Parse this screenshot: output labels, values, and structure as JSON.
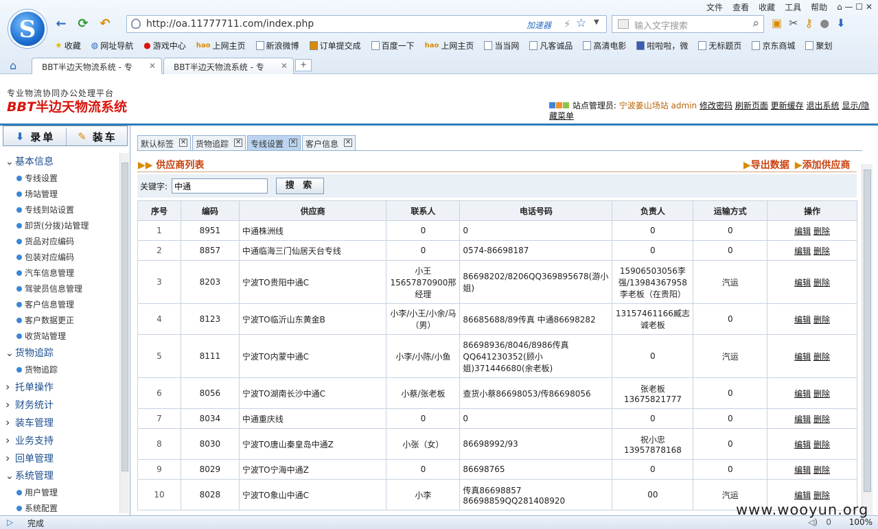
{
  "browser": {
    "menus": [
      "文件",
      "查看",
      "收藏",
      "工具",
      "帮助"
    ],
    "url": "http://oa.11777711.com/index.php",
    "accelerator": "加速器",
    "search_placeholder": "输入文字搜索",
    "favorites": [
      "收藏",
      "网址导航",
      "游戏中心",
      "上网主页",
      "新浪微博",
      "订单提交成",
      "百度一下",
      "上网主页",
      "当当网",
      "凡客诚品",
      "高清电影",
      "啦啦啦，微",
      "无标题页",
      "京东商城",
      "聚划"
    ],
    "tabs": [
      "BBT半边天物流系统 - 专",
      "BBT半边天物流系统 - 专"
    ],
    "status_text": "完成",
    "zoom": "100%",
    "status_count": "0"
  },
  "header": {
    "subtitle": "专业物流协同办公处理平台",
    "brand_latin": "BBT",
    "brand_cn": "半边天物流系统",
    "admin_label": "站点管理员:",
    "station": "宁波姜山场站",
    "user": "admin",
    "links": [
      "修改密码",
      "刷新页面",
      "更新缓存",
      "退出系统",
      "显示/隐藏菜单"
    ]
  },
  "sidebar": {
    "buttons": [
      "录单",
      "装车"
    ],
    "groups": [
      {
        "label": "基本信息",
        "expanded": true,
        "items": [
          "专线设置",
          "场站管理",
          "专线到站设置",
          "卸货(分拨)站管理",
          "货品对应编码",
          "包装对应编码",
          "汽车信息管理",
          "驾驶员信息管理",
          "客户信息管理",
          "客户数据更正",
          "收货站管理"
        ]
      },
      {
        "label": "货物追踪",
        "expanded": true,
        "items": [
          "货物追踪"
        ]
      },
      {
        "label": "托单操作",
        "expanded": false,
        "items": []
      },
      {
        "label": "财务统计",
        "expanded": false,
        "items": []
      },
      {
        "label": "装车管理",
        "expanded": false,
        "items": []
      },
      {
        "label": "业务支持",
        "expanded": false,
        "items": []
      },
      {
        "label": "回单管理",
        "expanded": false,
        "items": []
      },
      {
        "label": "系统管理",
        "expanded": true,
        "items": [
          "用户管理",
          "系统配置"
        ]
      }
    ]
  },
  "content": {
    "tabs": [
      {
        "label": "默认标签",
        "active": false
      },
      {
        "label": "货物追踪",
        "active": false
      },
      {
        "label": "专线设置",
        "active": true
      },
      {
        "label": "客户信息",
        "active": false
      }
    ],
    "list_title": "供应商列表",
    "export_label": "导出数据",
    "add_label": "添加供应商",
    "keyword_label": "关键字:",
    "keyword_value": "中通",
    "search_button": "搜 索",
    "table": {
      "headers": [
        "序号",
        "编码",
        "供应商",
        "联系人",
        "电话号码",
        "负责人",
        "运输方式",
        "操作"
      ],
      "edit_label": "编辑",
      "delete_label": "删除",
      "rows": [
        {
          "no": "1",
          "code": "8951",
          "supplier": "中通株洲线",
          "contact": "0",
          "phone": "0",
          "manager": "0",
          "transport": "0"
        },
        {
          "no": "2",
          "code": "8857",
          "supplier": "中通临海三门仙居天台专线",
          "contact": "0",
          "phone": "0574-86698187",
          "manager": "0",
          "transport": "0"
        },
        {
          "no": "3",
          "code": "8203",
          "supplier": "宁波TO贵阳中通C",
          "contact": "小王15657870900邢经理",
          "phone": "86698202/8206QQ369895678(游小姐)",
          "manager": "15906503056李强/13984367958李老板（在贵阳）",
          "transport": "汽运"
        },
        {
          "no": "4",
          "code": "8123",
          "supplier": "宁波TO临沂山东黄金B",
          "contact": "小李/小王/小余/马（男）",
          "phone": "86685688/89传真 中通86698282",
          "manager": "13157461166臧志诚老板",
          "transport": "0"
        },
        {
          "no": "5",
          "code": "8111",
          "supplier": "宁波TO内蒙中通C",
          "contact": "小李/小陈/小鱼",
          "phone": "86698936/8046/8986传真QQ641230352(顾小姐)371446680(余老板)",
          "manager": "0",
          "transport": "汽运"
        },
        {
          "no": "6",
          "code": "8056",
          "supplier": "宁波TO湖南长沙中通C",
          "contact": "小蔡/张老板",
          "phone": "查货小蔡86698053/传86698056",
          "manager": "张老板13675821777",
          "transport": "0"
        },
        {
          "no": "7",
          "code": "8034",
          "supplier": "中通重庆线",
          "contact": "0",
          "phone": "0",
          "manager": "0",
          "transport": "0"
        },
        {
          "no": "8",
          "code": "8030",
          "supplier": "宁波TO唐山秦皇岛中通Z",
          "contact": "小张（女）",
          "phone": "86698992/93",
          "manager": "祝小忠13957878168",
          "transport": "0"
        },
        {
          "no": "9",
          "code": "8029",
          "supplier": "宁波TO宁海中通Z",
          "contact": "0",
          "phone": "86698765",
          "manager": "0",
          "transport": "0"
        },
        {
          "no": "10",
          "code": "8028",
          "supplier": "宁波TO象山中通C",
          "contact": "小李",
          "phone": "传真86698857 86698859QQ281408920",
          "manager": "00",
          "transport": "汽运"
        }
      ]
    }
  },
  "watermark": "www.wooyun.org",
  "colors": {
    "accent": "#2f7bbd",
    "brand_red": "#d9140d",
    "title_orange": "#c9400e",
    "station_orange": "#b7650b"
  }
}
